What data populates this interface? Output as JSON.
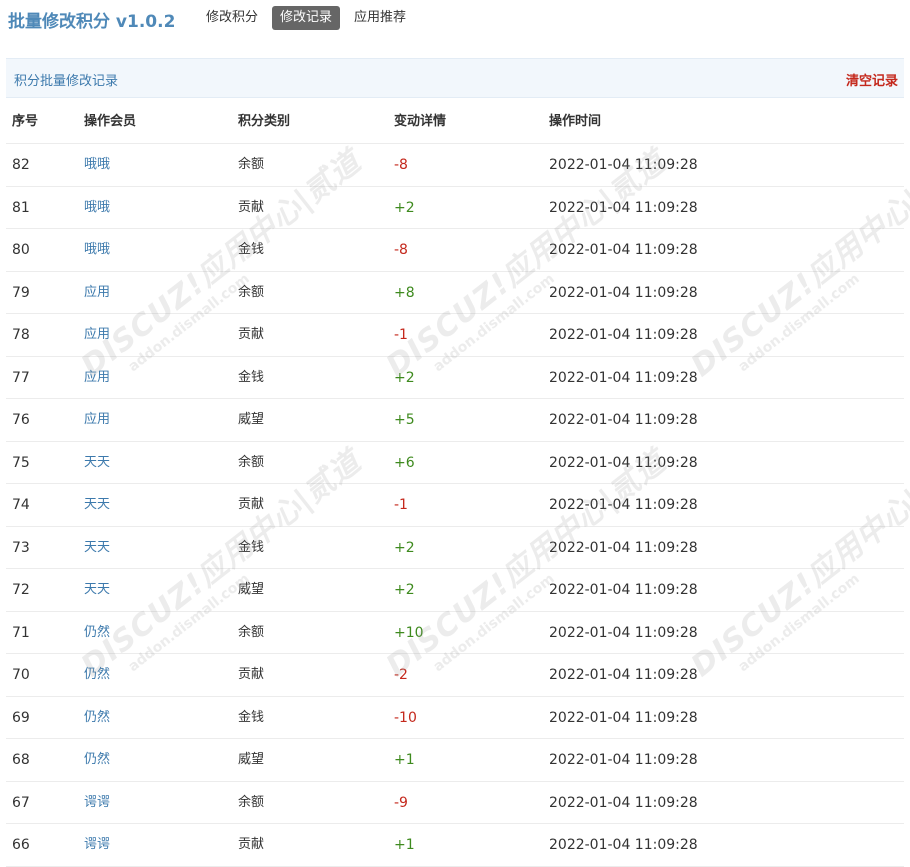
{
  "header": {
    "title": "批量修改积分 v1.0.2",
    "tabs": [
      {
        "label": "修改积分",
        "active": false
      },
      {
        "label": "修改记录",
        "active": true
      },
      {
        "label": "应用推荐",
        "active": false
      }
    ]
  },
  "section": {
    "title": "积分批量修改记录",
    "clear_label": "清空记录"
  },
  "table": {
    "columns": [
      "序号",
      "操作会员",
      "积分类别",
      "变动详情",
      "操作时间"
    ],
    "rows": [
      {
        "id": "82",
        "member": "哦哦",
        "type": "余额",
        "change": "-8",
        "time": "2022-01-04 11:09:28"
      },
      {
        "id": "81",
        "member": "哦哦",
        "type": "贡献",
        "change": "+2",
        "time": "2022-01-04 11:09:28"
      },
      {
        "id": "80",
        "member": "哦哦",
        "type": "金钱",
        "change": "-8",
        "time": "2022-01-04 11:09:28"
      },
      {
        "id": "79",
        "member": "应用",
        "type": "余额",
        "change": "+8",
        "time": "2022-01-04 11:09:28"
      },
      {
        "id": "78",
        "member": "应用",
        "type": "贡献",
        "change": "-1",
        "time": "2022-01-04 11:09:28"
      },
      {
        "id": "77",
        "member": "应用",
        "type": "金钱",
        "change": "+2",
        "time": "2022-01-04 11:09:28"
      },
      {
        "id": "76",
        "member": "应用",
        "type": "威望",
        "change": "+5",
        "time": "2022-01-04 11:09:28"
      },
      {
        "id": "75",
        "member": "天天",
        "type": "余额",
        "change": "+6",
        "time": "2022-01-04 11:09:28"
      },
      {
        "id": "74",
        "member": "天天",
        "type": "贡献",
        "change": "-1",
        "time": "2022-01-04 11:09:28"
      },
      {
        "id": "73",
        "member": "天天",
        "type": "金钱",
        "change": "+2",
        "time": "2022-01-04 11:09:28"
      },
      {
        "id": "72",
        "member": "天天",
        "type": "威望",
        "change": "+2",
        "time": "2022-01-04 11:09:28"
      },
      {
        "id": "71",
        "member": "仍然",
        "type": "余额",
        "change": "+10",
        "time": "2022-01-04 11:09:28"
      },
      {
        "id": "70",
        "member": "仍然",
        "type": "贡献",
        "change": "-2",
        "time": "2022-01-04 11:09:28"
      },
      {
        "id": "69",
        "member": "仍然",
        "type": "金钱",
        "change": "-10",
        "time": "2022-01-04 11:09:28"
      },
      {
        "id": "68",
        "member": "仍然",
        "type": "威望",
        "change": "+1",
        "time": "2022-01-04 11:09:28"
      },
      {
        "id": "67",
        "member": "谔谔",
        "type": "余额",
        "change": "-9",
        "time": "2022-01-04 11:09:28"
      },
      {
        "id": "66",
        "member": "谔谔",
        "type": "贡献",
        "change": "+1",
        "time": "2022-01-04 11:09:28"
      }
    ]
  },
  "watermark": {
    "main": "DISCUZ!应用中心|贰道",
    "sub": "addon.dismall.com"
  },
  "colors": {
    "negative": "#c4281c",
    "positive": "#3e8a1e",
    "accent": "#3c79ac"
  }
}
